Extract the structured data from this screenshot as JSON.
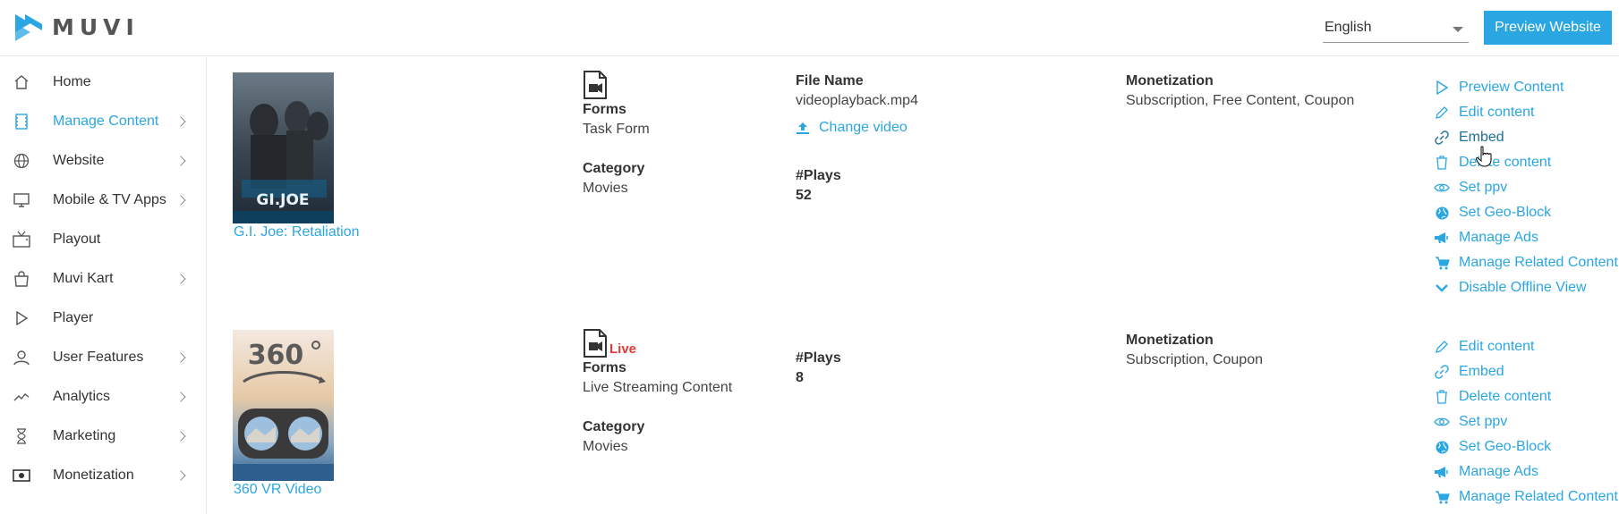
{
  "app": {
    "logo_text": "MUVI"
  },
  "header": {
    "language": "English",
    "preview_button": "Preview Website"
  },
  "sidebar": {
    "items": [
      {
        "label": "Home",
        "icon": "home-icon",
        "has_submenu": false,
        "active": false
      },
      {
        "label": "Manage Content",
        "icon": "film-icon",
        "has_submenu": true,
        "active": true
      },
      {
        "label": "Website",
        "icon": "globe-icon",
        "has_submenu": true,
        "active": false
      },
      {
        "label": "Mobile & TV Apps",
        "icon": "monitor-icon",
        "has_submenu": true,
        "active": false
      },
      {
        "label": "Playout",
        "icon": "tv-icon",
        "has_submenu": false,
        "active": false
      },
      {
        "label": "Muvi Kart",
        "icon": "shopping-bag-icon",
        "has_submenu": true,
        "active": false
      },
      {
        "label": "Player",
        "icon": "play-icon",
        "has_submenu": false,
        "active": false
      },
      {
        "label": "User Features",
        "icon": "user-icon",
        "has_submenu": true,
        "active": false
      },
      {
        "label": "Analytics",
        "icon": "chart-line-icon",
        "has_submenu": true,
        "active": false
      },
      {
        "label": "Marketing",
        "icon": "hourglass-icon",
        "has_submenu": true,
        "active": false
      },
      {
        "label": "Monetization",
        "icon": "money-icon",
        "has_submenu": true,
        "active": false
      }
    ]
  },
  "content": [
    {
      "title": "G.I. Joe: Retaliation",
      "forms_label": "Forms",
      "forms_value": "Task Form",
      "category_label": "Category",
      "category_value": "Movies",
      "file_name_label": "File Name",
      "file_name_value": "videoplayback.mp4",
      "change_video": "Change video",
      "plays_label": "#Plays",
      "plays_value": "52",
      "monetization_label": "Monetization",
      "monetization_value": "Subscription, Free Content, Coupon",
      "actions": [
        {
          "label": "Preview Content",
          "icon": "play-outline-icon"
        },
        {
          "label": "Edit content",
          "icon": "pencil-icon"
        },
        {
          "label": "Embed",
          "icon": "link-icon"
        },
        {
          "label": "Delete content",
          "icon": "trash-icon"
        },
        {
          "label": "Set ppv",
          "icon": "eye-icon"
        },
        {
          "label": "Set Geo-Block",
          "icon": "globe-solid-icon"
        },
        {
          "label": "Manage Ads",
          "icon": "megaphone-icon"
        },
        {
          "label": "Manage Related Content",
          "icon": "cart-icon"
        },
        {
          "label": "Disable Offline View",
          "icon": "chevron-down-icon"
        }
      ]
    },
    {
      "title": "360 VR Video",
      "live_badge": "Live",
      "forms_label": "Forms",
      "forms_value": "Live Streaming Content",
      "category_label": "Category",
      "category_value": "Movies",
      "plays_label": "#Plays",
      "plays_value": "8",
      "monetization_label": "Monetization",
      "monetization_value": "Subscription, Coupon",
      "actions": [
        {
          "label": "Edit content",
          "icon": "pencil-icon"
        },
        {
          "label": "Embed",
          "icon": "link-icon"
        },
        {
          "label": "Delete content",
          "icon": "trash-icon"
        },
        {
          "label": "Set ppv",
          "icon": "eye-icon"
        },
        {
          "label": "Set Geo-Block",
          "icon": "globe-solid-icon"
        },
        {
          "label": "Manage Ads",
          "icon": "megaphone-icon"
        },
        {
          "label": "Manage Related Content",
          "icon": "cart-icon"
        }
      ]
    }
  ],
  "colors": {
    "accent": "#2aa6e3",
    "live": "#e53935",
    "hover_link": "#1d6f98"
  }
}
